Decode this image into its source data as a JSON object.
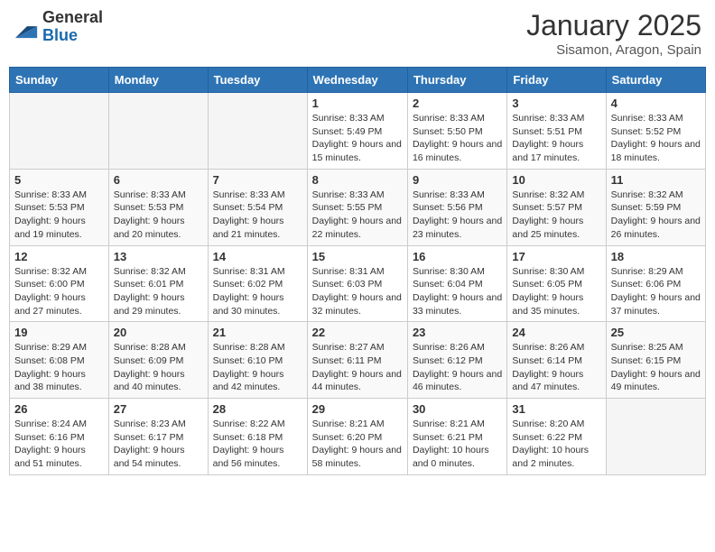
{
  "logo": {
    "general": "General",
    "blue": "Blue"
  },
  "header": {
    "month": "January 2025",
    "location": "Sisamon, Aragon, Spain"
  },
  "weekdays": [
    "Sunday",
    "Monday",
    "Tuesday",
    "Wednesday",
    "Thursday",
    "Friday",
    "Saturday"
  ],
  "weeks": [
    [
      {
        "day": "",
        "info": ""
      },
      {
        "day": "",
        "info": ""
      },
      {
        "day": "",
        "info": ""
      },
      {
        "day": "1",
        "info": "Sunrise: 8:33 AM\nSunset: 5:49 PM\nDaylight: 9 hours and 15 minutes."
      },
      {
        "day": "2",
        "info": "Sunrise: 8:33 AM\nSunset: 5:50 PM\nDaylight: 9 hours and 16 minutes."
      },
      {
        "day": "3",
        "info": "Sunrise: 8:33 AM\nSunset: 5:51 PM\nDaylight: 9 hours and 17 minutes."
      },
      {
        "day": "4",
        "info": "Sunrise: 8:33 AM\nSunset: 5:52 PM\nDaylight: 9 hours and 18 minutes."
      }
    ],
    [
      {
        "day": "5",
        "info": "Sunrise: 8:33 AM\nSunset: 5:53 PM\nDaylight: 9 hours and 19 minutes."
      },
      {
        "day": "6",
        "info": "Sunrise: 8:33 AM\nSunset: 5:53 PM\nDaylight: 9 hours and 20 minutes."
      },
      {
        "day": "7",
        "info": "Sunrise: 8:33 AM\nSunset: 5:54 PM\nDaylight: 9 hours and 21 minutes."
      },
      {
        "day": "8",
        "info": "Sunrise: 8:33 AM\nSunset: 5:55 PM\nDaylight: 9 hours and 22 minutes."
      },
      {
        "day": "9",
        "info": "Sunrise: 8:33 AM\nSunset: 5:56 PM\nDaylight: 9 hours and 23 minutes."
      },
      {
        "day": "10",
        "info": "Sunrise: 8:32 AM\nSunset: 5:57 PM\nDaylight: 9 hours and 25 minutes."
      },
      {
        "day": "11",
        "info": "Sunrise: 8:32 AM\nSunset: 5:59 PM\nDaylight: 9 hours and 26 minutes."
      }
    ],
    [
      {
        "day": "12",
        "info": "Sunrise: 8:32 AM\nSunset: 6:00 PM\nDaylight: 9 hours and 27 minutes."
      },
      {
        "day": "13",
        "info": "Sunrise: 8:32 AM\nSunset: 6:01 PM\nDaylight: 9 hours and 29 minutes."
      },
      {
        "day": "14",
        "info": "Sunrise: 8:31 AM\nSunset: 6:02 PM\nDaylight: 9 hours and 30 minutes."
      },
      {
        "day": "15",
        "info": "Sunrise: 8:31 AM\nSunset: 6:03 PM\nDaylight: 9 hours and 32 minutes."
      },
      {
        "day": "16",
        "info": "Sunrise: 8:30 AM\nSunset: 6:04 PM\nDaylight: 9 hours and 33 minutes."
      },
      {
        "day": "17",
        "info": "Sunrise: 8:30 AM\nSunset: 6:05 PM\nDaylight: 9 hours and 35 minutes."
      },
      {
        "day": "18",
        "info": "Sunrise: 8:29 AM\nSunset: 6:06 PM\nDaylight: 9 hours and 37 minutes."
      }
    ],
    [
      {
        "day": "19",
        "info": "Sunrise: 8:29 AM\nSunset: 6:08 PM\nDaylight: 9 hours and 38 minutes."
      },
      {
        "day": "20",
        "info": "Sunrise: 8:28 AM\nSunset: 6:09 PM\nDaylight: 9 hours and 40 minutes."
      },
      {
        "day": "21",
        "info": "Sunrise: 8:28 AM\nSunset: 6:10 PM\nDaylight: 9 hours and 42 minutes."
      },
      {
        "day": "22",
        "info": "Sunrise: 8:27 AM\nSunset: 6:11 PM\nDaylight: 9 hours and 44 minutes."
      },
      {
        "day": "23",
        "info": "Sunrise: 8:26 AM\nSunset: 6:12 PM\nDaylight: 9 hours and 46 minutes."
      },
      {
        "day": "24",
        "info": "Sunrise: 8:26 AM\nSunset: 6:14 PM\nDaylight: 9 hours and 47 minutes."
      },
      {
        "day": "25",
        "info": "Sunrise: 8:25 AM\nSunset: 6:15 PM\nDaylight: 9 hours and 49 minutes."
      }
    ],
    [
      {
        "day": "26",
        "info": "Sunrise: 8:24 AM\nSunset: 6:16 PM\nDaylight: 9 hours and 51 minutes."
      },
      {
        "day": "27",
        "info": "Sunrise: 8:23 AM\nSunset: 6:17 PM\nDaylight: 9 hours and 54 minutes."
      },
      {
        "day": "28",
        "info": "Sunrise: 8:22 AM\nSunset: 6:18 PM\nDaylight: 9 hours and 56 minutes."
      },
      {
        "day": "29",
        "info": "Sunrise: 8:21 AM\nSunset: 6:20 PM\nDaylight: 9 hours and 58 minutes."
      },
      {
        "day": "30",
        "info": "Sunrise: 8:21 AM\nSunset: 6:21 PM\nDaylight: 10 hours and 0 minutes."
      },
      {
        "day": "31",
        "info": "Sunrise: 8:20 AM\nSunset: 6:22 PM\nDaylight: 10 hours and 2 minutes."
      },
      {
        "day": "",
        "info": ""
      }
    ]
  ]
}
